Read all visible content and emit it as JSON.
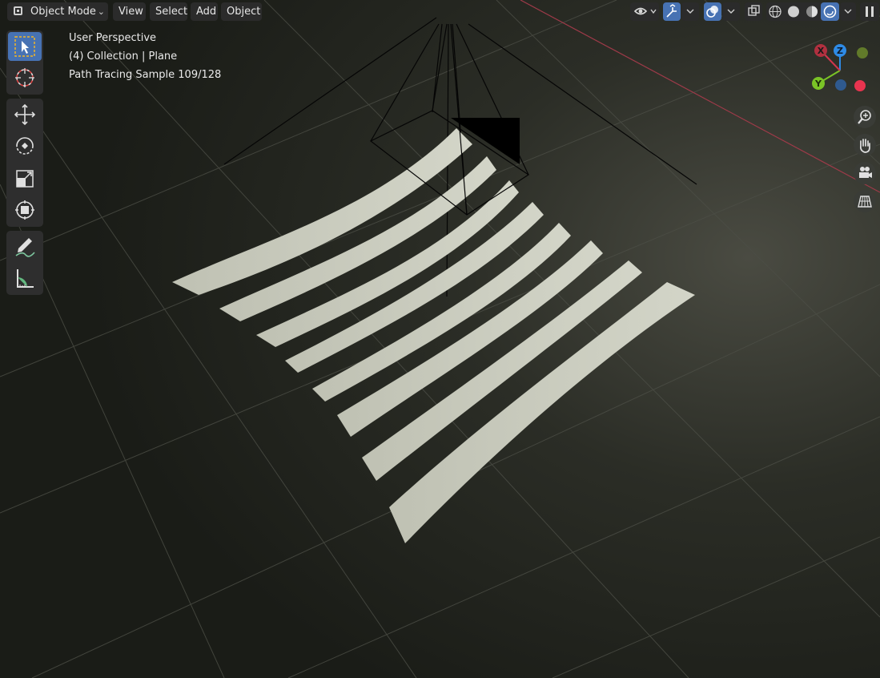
{
  "header": {
    "mode_label": "Object Mode",
    "menus": [
      "View",
      "Select",
      "Add",
      "Object"
    ],
    "right_icons": [
      "visibility-icon",
      "gizmo-toggle-icon",
      "overlay-toggle-icon",
      "xray-icon",
      "wireframe-shading-icon",
      "solid-shading-icon",
      "material-shading-icon",
      "rendered-shading-icon",
      "pause-render-icon"
    ]
  },
  "overlay": {
    "perspective": "User Perspective",
    "collection": "(4) Collection | Plane",
    "render_status": "Path Tracing Sample 109/128"
  },
  "gizmo": {
    "x_label": "X",
    "y_label": "Y",
    "z_label": "Z",
    "x_color": "#d2354d",
    "y_color": "#7ac326",
    "z_color": "#2e8be6"
  },
  "toolbar": {
    "tools": [
      "select-box-icon",
      "cursor-icon",
      "move-icon",
      "rotate-icon",
      "scale-icon",
      "transform-icon",
      "annotate-icon",
      "measure-icon"
    ]
  },
  "nav_buttons": [
    "zoom-icon",
    "pan-hand-icon",
    "camera-view-icon",
    "orthographic-grid-icon"
  ],
  "colors": {
    "accent": "#4772b3",
    "header_button": "#2b2b2b",
    "toolbar_bg": "#2e2e2e",
    "stripe": "#c9cbbe",
    "x_axis_line": "#9e3a49"
  }
}
